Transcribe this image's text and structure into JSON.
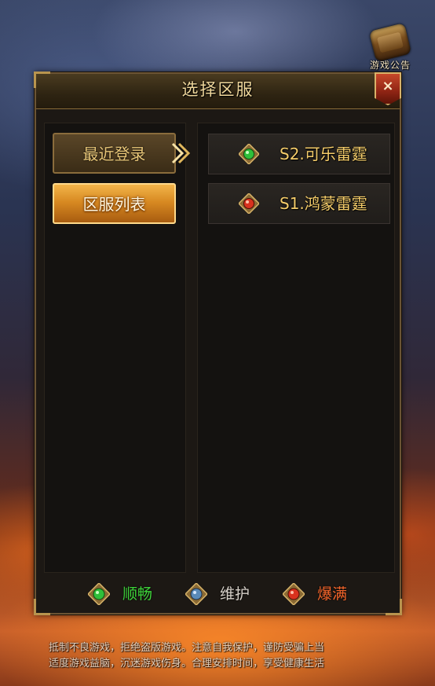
{
  "notice": {
    "label": "游戏公告",
    "icon": "scroll-icon"
  },
  "dialog": {
    "title": "选择区服",
    "close_label": "×"
  },
  "tabs": [
    {
      "label": "最近登录",
      "selected": false
    },
    {
      "label": "区服列表",
      "selected": true
    }
  ],
  "servers": [
    {
      "name": "S2.可乐雷霆",
      "status": "green",
      "status_icon": "green-gem-icon"
    },
    {
      "name": "S1.鸿蒙雷霆",
      "status": "red",
      "status_icon": "red-gem-icon"
    }
  ],
  "legend": [
    {
      "label": "顺畅",
      "color": "#3ed23a",
      "icon": "green-gem-icon"
    },
    {
      "label": "维护",
      "color": "#d6d0c8",
      "icon": "blue-gem-icon"
    },
    {
      "label": "爆满",
      "color": "#f2642a",
      "icon": "red-gem-icon"
    }
  ],
  "colors": {
    "gem_green": "#2fbf3a",
    "gem_blue": "#5a8ab8",
    "gem_red": "#d8321e",
    "gold": "#f4cc6a"
  },
  "footer": {
    "line1": "抵制不良游戏，拒绝盗版游戏。注意自我保护，谨防受骗上当",
    "line2": "适度游戏益脑，沉迷游戏伤身。合理安排时间，享受健康生活"
  }
}
